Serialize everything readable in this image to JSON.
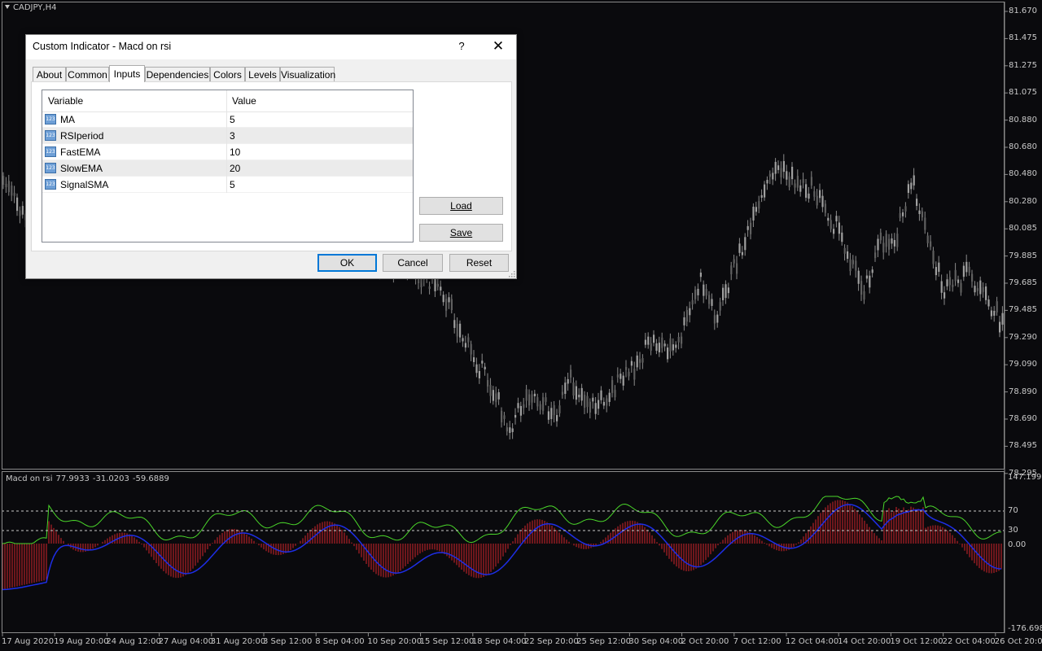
{
  "chart": {
    "symbol": "CADJPY,H4",
    "price_axis": [
      "81.670",
      "81.475",
      "81.275",
      "81.075",
      "80.880",
      "80.680",
      "80.480",
      "80.280",
      "80.085",
      "79.885",
      "79.685",
      "79.485",
      "79.290",
      "79.090",
      "78.890",
      "78.690",
      "78.495",
      "78.295"
    ],
    "indicator_label": {
      "name": "Macd on rsi",
      "v1": "77.9933",
      "v2": "-31.0203",
      "v3": "-59.6889"
    },
    "indicator_axis": {
      "top": "147.1993",
      "l70": "70",
      "l30": "30",
      "zero": "0.00",
      "bottom": "-176.6984"
    },
    "time_axis": [
      "17 Aug 2020",
      "19 Aug 20:00",
      "24 Aug 12:00",
      "27 Aug 04:00",
      "31 Aug 20:00",
      "3 Sep 12:00",
      "8 Sep 04:00",
      "10 Sep 20:00",
      "15 Sep 12:00",
      "18 Sep 04:00",
      "22 Sep 20:00",
      "25 Sep 12:00",
      "30 Sep 04:00",
      "2 Oct 20:00",
      "7 Oct 12:00",
      "12 Oct 04:00",
      "14 Oct 20:00",
      "19 Oct 12:00",
      "22 Oct 04:00",
      "26 Oct 20:00"
    ],
    "colors": {
      "background": "#0a0a0d",
      "candle": "#8a8a8a",
      "histogram": "#d2242b",
      "signal": "#1e2ee6",
      "rsi": "#4ad62a",
      "grid": "#8a8a8a",
      "level": "#c8c8c8"
    }
  },
  "dialog": {
    "title": "Custom Indicator - Macd on rsi",
    "help": "?",
    "close": "✕",
    "tabs": [
      "About",
      "Common",
      "Inputs",
      "Dependencies",
      "Colors",
      "Levels",
      "Visualization"
    ],
    "active_tab": "Inputs",
    "grid": {
      "col_variable": "Variable",
      "col_value": "Value",
      "rows": [
        {
          "variable": "MA",
          "value": "5",
          "icon": "number-icon"
        },
        {
          "variable": "RSIperiod",
          "value": "3",
          "icon": "number-icon"
        },
        {
          "variable": "FastEMA",
          "value": "10",
          "icon": "number-icon"
        },
        {
          "variable": "SlowEMA",
          "value": "20",
          "icon": "number-icon"
        },
        {
          "variable": "SignalSMA",
          "value": "5",
          "icon": "number-icon"
        }
      ]
    },
    "load_label": "Load",
    "save_label": "Save",
    "ok_label": "OK",
    "cancel_label": "Cancel",
    "reset_label": "Reset"
  }
}
